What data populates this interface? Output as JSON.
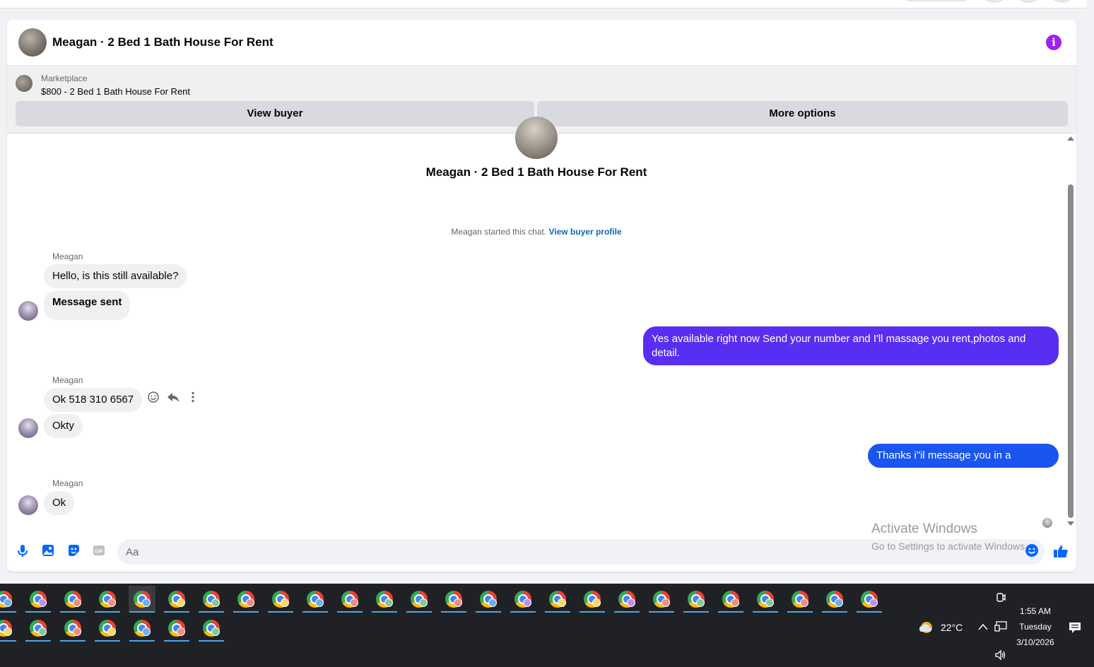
{
  "header": {
    "title": "Meagan · 2 Bed 1 Bath House For Rent",
    "info_icon": "i"
  },
  "marketplace": {
    "label": "Marketplace",
    "listing": "$800 - 2 Bed 1 Bath House For Rent",
    "view_buyer": "View buyer",
    "more_options": "More options"
  },
  "conversation": {
    "title": "Meagan · 2 Bed 1 Bath House For Rent",
    "started_text": "Meagan started this chat.",
    "view_profile": "View buyer profile",
    "messages": [
      {
        "sender": "Meagan",
        "text": "Hello, is this still available?"
      },
      {
        "text": "Message sent"
      },
      {
        "me": true,
        "text": "Yes available right now Send your number and I'll massage you rent,photos and detail."
      },
      {
        "sender": "Meagan",
        "text": "Ok 518 310 6567"
      },
      {
        "text": "Okty"
      },
      {
        "me": true,
        "text": "Thanks i\"il message you in a moment"
      },
      {
        "sender": "Meagan",
        "text": "Ok"
      }
    ]
  },
  "composer": {
    "placeholder": "Aa",
    "icons": [
      "microphone-icon",
      "photo-icon",
      "sticker-icon",
      "gif-icon",
      "emoji-icon",
      "like-icon"
    ]
  },
  "watermark": {
    "line1": "Activate Windows",
    "line2": "Go to Settings to activate Windows."
  },
  "taskbar": {
    "weather": "22°C",
    "time": "1:55 AM",
    "day": "Tuesday",
    "date": "3/10/2026"
  },
  "colors": {
    "accent": "#0866ff",
    "bubble_out_1": "#5a2ef2",
    "bubble_out_2": "#1a55f0",
    "bubble_in": "#f0f0f0",
    "info": "#a020f0"
  }
}
